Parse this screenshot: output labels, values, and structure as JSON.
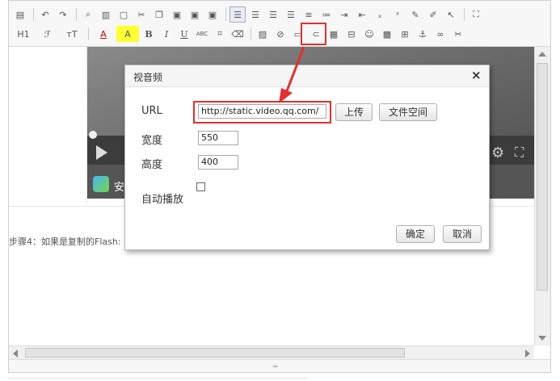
{
  "toolbar": {
    "row2_labels": {
      "heading": "H1",
      "font_family": "ℱ",
      "font_size": "тT",
      "font_color": "A",
      "bg_color": "A",
      "bold": "B",
      "italic": "I",
      "underline": "U",
      "small_caps": "ABC"
    },
    "highlighted_tool": "insert-video-icon",
    "highlight_color": "#e03030"
  },
  "content": {
    "video_logo_text": "安",
    "step_text": "步骤4：如果是复制的Flash:"
  },
  "dialog": {
    "title": "视音频",
    "close_symbol": "×",
    "url_label": "URL",
    "url_value": "http://static.video.qq.com/",
    "upload_label": "上传",
    "file_space_label": "文件空间",
    "width_label": "宽度",
    "width_value": "550",
    "height_label": "高度",
    "height_value": "400",
    "autoplay_label": "自动播放",
    "autoplay_checked": false,
    "ok_label": "确定",
    "cancel_label": "取消"
  },
  "colors": {
    "annotation_red": "#e03030",
    "toolbar_bg": "#f7f7f7",
    "dialog_header_bg": "#f5f5f5"
  }
}
